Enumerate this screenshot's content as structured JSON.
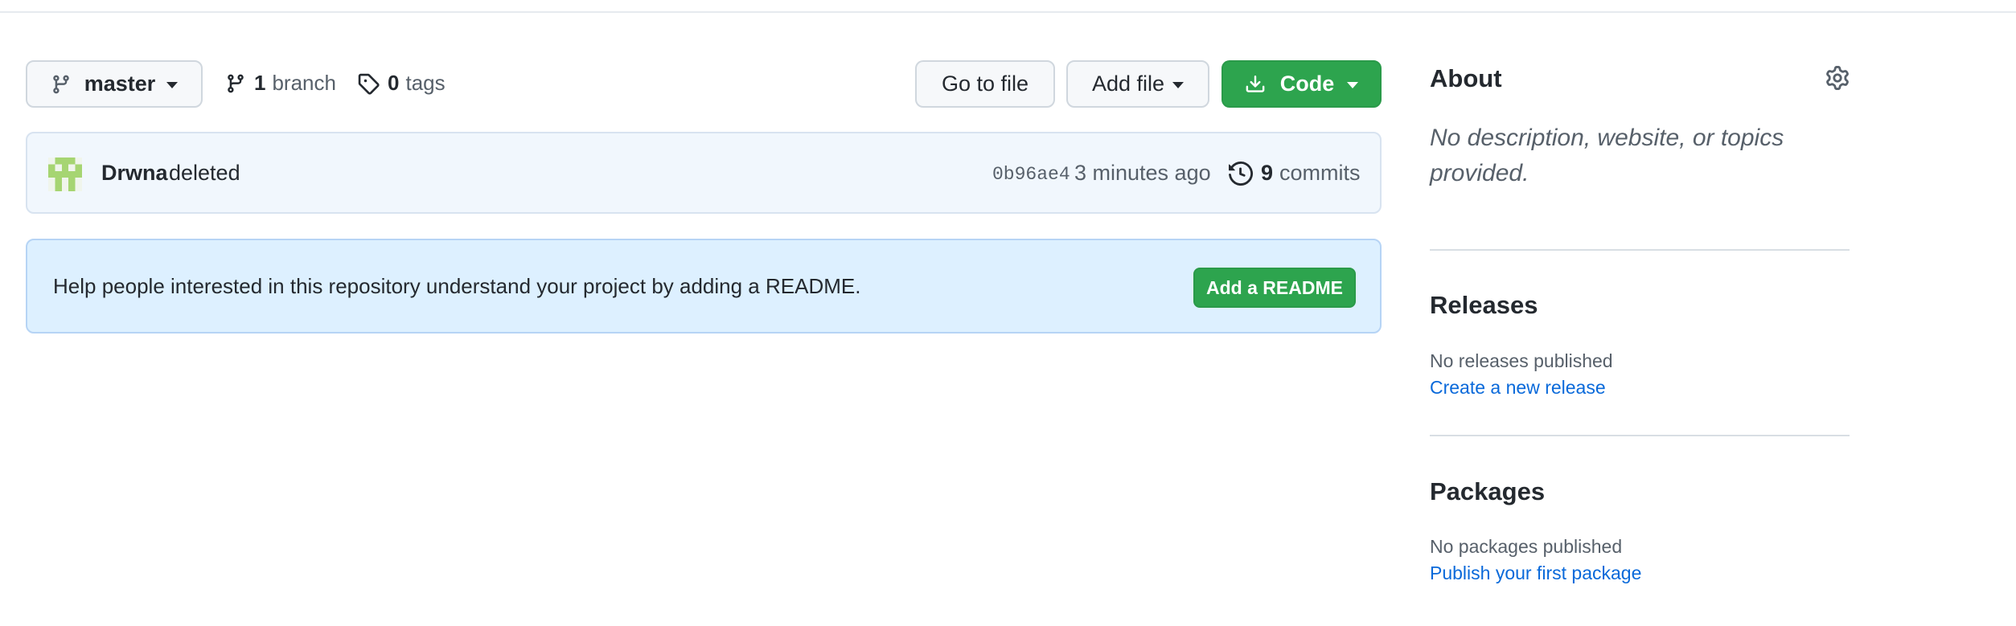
{
  "toolbar": {
    "branch_name": "master",
    "branch_count": "1",
    "branch_label": "branch",
    "tag_count": "0",
    "tag_label": "tags",
    "go_to_file": "Go to file",
    "add_file": "Add file",
    "code": "Code"
  },
  "commit": {
    "author": "Drwna",
    "message": "deleted",
    "sha": "0b96ae4",
    "time": "3 minutes ago",
    "commit_count": "9",
    "commit_label": "commits"
  },
  "readme_banner": {
    "text": "Help people interested in this repository understand your project by adding a README.",
    "button": "Add a README"
  },
  "sidebar": {
    "about_title": "About",
    "about_description": "No description, website, or topics provided.",
    "releases_title": "Releases",
    "releases_status": "No releases published",
    "releases_link": "Create a new release",
    "packages_title": "Packages",
    "packages_status": "No packages published",
    "packages_link": "Publish your first package"
  },
  "colors": {
    "accent_green": "#2da44e",
    "link_blue": "#0969da",
    "banner_blue": "#ddf0ff",
    "commit_bar": "#f1f7fd"
  },
  "icons": [
    "branch-icon",
    "tag-icon",
    "download-icon",
    "history-icon",
    "gear-icon",
    "avatar-identicon"
  ]
}
